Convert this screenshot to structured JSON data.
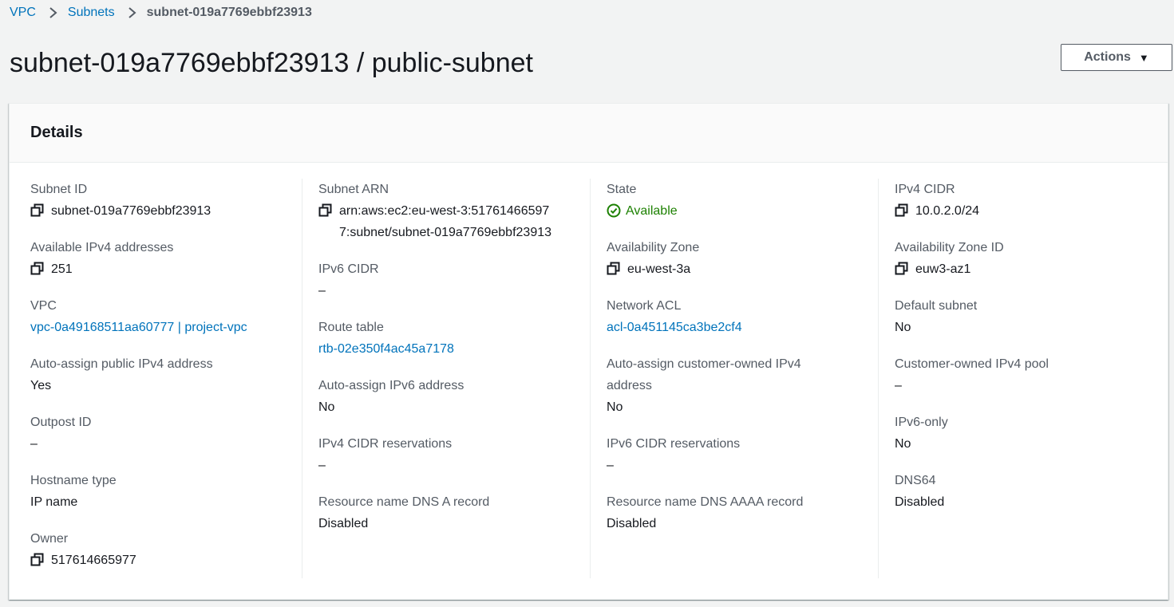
{
  "breadcrumb": {
    "vpc": "VPC",
    "subnets": "Subnets",
    "current": "subnet-019a7769ebbf23913"
  },
  "page_title": "subnet-019a7769ebbf23913 / public-subnet",
  "actions_label": "Actions",
  "details_title": "Details",
  "col1": {
    "subnet_id": {
      "label": "Subnet ID",
      "value": "subnet-019a7769ebbf23913"
    },
    "available_ipv4": {
      "label": "Available IPv4 addresses",
      "value": "251"
    },
    "vpc": {
      "label": "VPC",
      "value": "vpc-0a49168511aa60777 | project-vpc"
    },
    "auto_assign_public_ipv4": {
      "label": "Auto-assign public IPv4 address",
      "value": "Yes"
    },
    "outpost_id": {
      "label": "Outpost ID",
      "value": "–"
    },
    "hostname_type": {
      "label": "Hostname type",
      "value": "IP name"
    },
    "owner": {
      "label": "Owner",
      "value": "517614665977"
    }
  },
  "col2": {
    "subnet_arn": {
      "label": "Subnet ARN",
      "value": "arn:aws:ec2:eu-west-3:517614665977:subnet/subnet-019a7769ebbf23913"
    },
    "ipv6_cidr": {
      "label": "IPv6 CIDR",
      "value": "–"
    },
    "route_table": {
      "label": "Route table",
      "value": "rtb-02e350f4ac45a7178"
    },
    "auto_assign_ipv6": {
      "label": "Auto-assign IPv6 address",
      "value": "No"
    },
    "ipv4_cidr_reservations": {
      "label": "IPv4 CIDR reservations",
      "value": "–"
    },
    "dns_a_record": {
      "label": "Resource name DNS A record",
      "value": "Disabled"
    }
  },
  "col3": {
    "state": {
      "label": "State",
      "value": "Available"
    },
    "availability_zone": {
      "label": "Availability Zone",
      "value": "eu-west-3a"
    },
    "network_acl": {
      "label": "Network ACL",
      "value": "acl-0a451145ca3be2cf4"
    },
    "auto_assign_customer_owned_ipv4": {
      "label": "Auto-assign customer-owned IPv4 address",
      "value": "No"
    },
    "ipv6_cidr_reservations": {
      "label": "IPv6 CIDR reservations",
      "value": "–"
    },
    "dns_aaaa_record": {
      "label": "Resource name DNS AAAA record",
      "value": "Disabled"
    }
  },
  "col4": {
    "ipv4_cidr": {
      "label": "IPv4 CIDR",
      "value": "10.0.2.0/24"
    },
    "availability_zone_id": {
      "label": "Availability Zone ID",
      "value": "euw3-az1"
    },
    "default_subnet": {
      "label": "Default subnet",
      "value": "No"
    },
    "customer_owned_ipv4_pool": {
      "label": "Customer-owned IPv4 pool",
      "value": "–"
    },
    "ipv6_only": {
      "label": "IPv6-only",
      "value": "No"
    },
    "dns64": {
      "label": "DNS64",
      "value": "Disabled"
    }
  },
  "colors": {
    "link": "#0073bb",
    "success": "#1d8102",
    "label": "#545b64",
    "text": "#16191f",
    "background": "#f2f3f3"
  }
}
